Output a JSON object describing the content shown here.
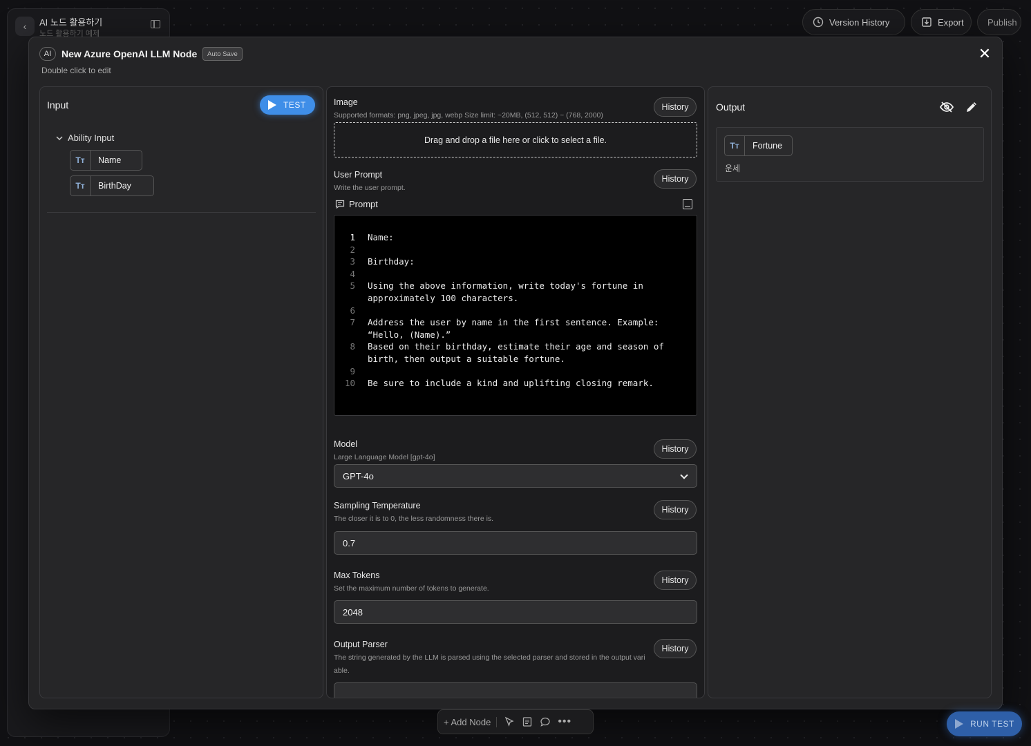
{
  "project": {
    "title": "AI 노드 활용하기",
    "subtitle": "노드 활용하기 예제"
  },
  "toolbar": {
    "version_history": "Version History",
    "export": "Export",
    "publish": "Publish"
  },
  "node": {
    "badge": "AI",
    "title": "New Azure OpenAI LLM Node",
    "autosave": "Auto Save",
    "hint": "Double click to edit"
  },
  "input_panel": {
    "title": "Input",
    "test_label": "TEST",
    "group_label": "Ability Input",
    "variables": [
      {
        "type_icon": "Tт",
        "name": "Name"
      },
      {
        "type_icon": "Tт",
        "name": "BirthDay"
      }
    ]
  },
  "config": {
    "history_label": "History",
    "image": {
      "label": "Image",
      "desc": "Supported formats: png, jpeg, jpg, webp Size limit: ~20MB, (512, 512) ~ (768, 2000)",
      "dropzone": "Drag and drop a file here or click to select a file."
    },
    "user_prompt": {
      "label": "User Prompt",
      "desc": "Write the user prompt.",
      "editor_title": "Prompt",
      "lines": [
        {
          "n": "1",
          "text": "Name:"
        },
        {
          "n": "2",
          "text": ""
        },
        {
          "n": "3",
          "text": "Birthday:"
        },
        {
          "n": "4",
          "text": ""
        },
        {
          "n": "5",
          "text": "Using the above information, write today's fortune in approximately 100 characters."
        },
        {
          "n": "6",
          "text": ""
        },
        {
          "n": "7",
          "text": "Address the user by name in the first sentence. Example: “Hello, (Name).”"
        },
        {
          "n": "8",
          "text": "Based on their birthday, estimate their age and season of birth, then output a suitable fortune."
        },
        {
          "n": "9",
          "text": ""
        },
        {
          "n": "10",
          "text": "Be sure to include a kind and uplifting closing remark."
        }
      ]
    },
    "model": {
      "label": "Model",
      "desc": "Large Language Model [gpt-4o]",
      "value": "GPT-4o"
    },
    "temperature": {
      "label": "Sampling Temperature",
      "desc": "The closer it is to 0, the less randomness there is.",
      "value": "0.7"
    },
    "max_tokens": {
      "label": "Max Tokens",
      "desc": "Set the maximum number of tokens to generate.",
      "value": "2048"
    },
    "output_parser": {
      "label": "Output Parser",
      "desc": "The string generated by the LLM is parsed using the selected parser and stored in the output variable."
    }
  },
  "output_panel": {
    "title": "Output",
    "variable": {
      "type_icon": "Tт",
      "name": "Fortune",
      "description": "운세"
    }
  },
  "bottom_bar": {
    "add_node": "+ Add Node",
    "run_test": "RUN TEST"
  }
}
